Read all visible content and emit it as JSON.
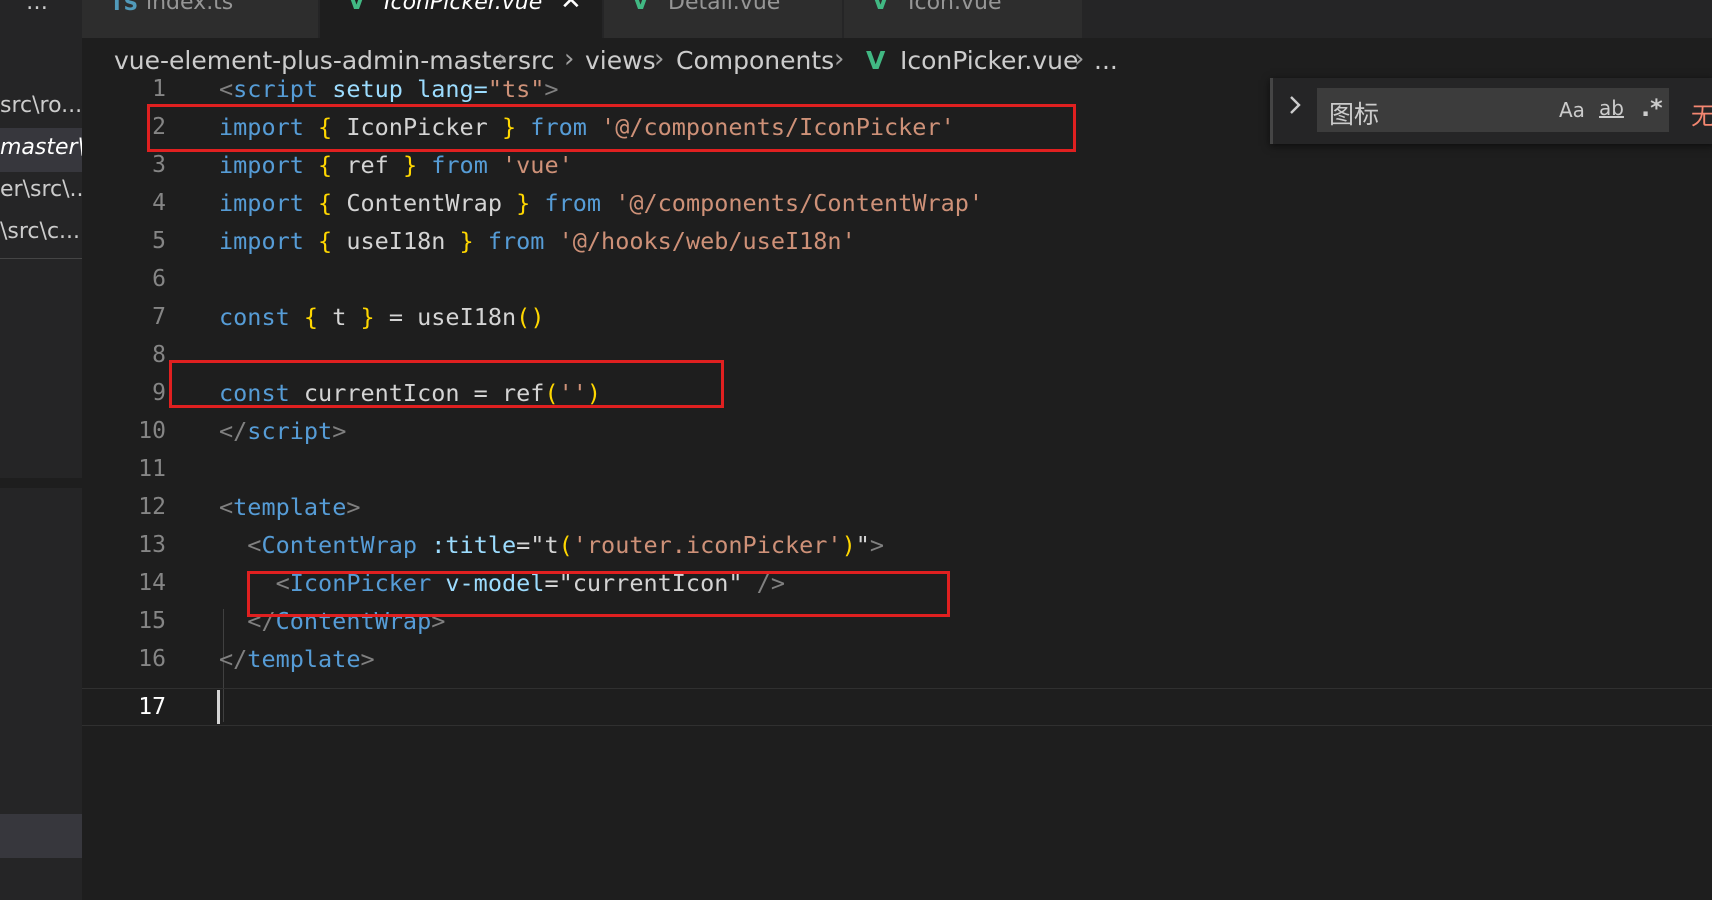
{
  "sidebar": {
    "overflow_label": "…",
    "items": [
      {
        "label": "src\\ro..."
      },
      {
        "label": "master\\..."
      },
      {
        "label": "er\\src\\..."
      },
      {
        "label": "\\src\\c..."
      }
    ]
  },
  "tabs": [
    {
      "icon": "TS",
      "label": "index.ts",
      "active": false
    },
    {
      "icon": "V",
      "label": "IconPicker.vue",
      "active": true,
      "close": "✕"
    },
    {
      "icon": "V",
      "label": "Detail.vue",
      "active": false
    },
    {
      "icon": "V",
      "label": "Icon.vue",
      "active": false
    }
  ],
  "breadcrumb": {
    "parts": [
      "vue-element-plus-admin-master",
      "src",
      "views",
      "Components",
      "IconPicker.vue",
      "..."
    ],
    "separator": "›",
    "file_icon": "V"
  },
  "editor": {
    "lines": [
      {
        "n": "1"
      },
      {
        "n": "2"
      },
      {
        "n": "3"
      },
      {
        "n": "4"
      },
      {
        "n": "5"
      },
      {
        "n": "6"
      },
      {
        "n": "7"
      },
      {
        "n": "8"
      },
      {
        "n": "9"
      },
      {
        "n": "10"
      },
      {
        "n": "11"
      },
      {
        "n": "12"
      },
      {
        "n": "13"
      },
      {
        "n": "14"
      },
      {
        "n": "15"
      },
      {
        "n": "16"
      },
      {
        "n": "17"
      }
    ],
    "code": {
      "l1": [
        "<",
        "script",
        " setup lang=",
        "\"ts\"",
        ">"
      ],
      "l2": [
        "import",
        " ",
        "{",
        " IconPicker ",
        "}",
        " ",
        "from",
        " ",
        "'@/components/IconPicker'"
      ],
      "l3": [
        "import",
        " ",
        "{",
        " ref ",
        "}",
        " ",
        "from",
        " ",
        "'vue'"
      ],
      "l4": [
        "import",
        " ",
        "{",
        " ContentWrap ",
        "}",
        " ",
        "from",
        " ",
        "'@/components/ContentWrap'"
      ],
      "l5": [
        "import",
        " ",
        "{",
        " useI18n ",
        "}",
        " ",
        "from",
        " ",
        "'@/hooks/web/useI18n'"
      ],
      "l7": [
        "const",
        " ",
        "{",
        " t ",
        "}",
        " = ",
        "useI18n",
        "()",
        ""
      ],
      "l9": [
        "const",
        " currentIcon = ",
        "ref",
        "(",
        "''",
        ")"
      ],
      "l10": [
        "</",
        "script",
        ">"
      ],
      "l12": [
        "<",
        "template",
        ">"
      ],
      "l13": [
        "  <",
        "ContentWrap",
        " ",
        ":title",
        "=",
        "\"",
        "t",
        "(",
        "'router.iconPicker'",
        ")",
        "\"",
        ">"
      ],
      "l14": [
        "    <",
        "IconPicker",
        " ",
        "v-model",
        "=",
        "\"currentIcon\"",
        " />"
      ],
      "l15": [
        "  </",
        "ContentWrap",
        ">"
      ],
      "l16": [
        "</",
        "template",
        ">"
      ]
    },
    "current_line": "17"
  },
  "find_widget": {
    "query": "图标",
    "match_case": "Aa",
    "whole_word": "ab",
    "regex": ".*",
    "result": "无结果"
  },
  "colors": {
    "highlight_box": "#e02020",
    "keyword": "#569cd6",
    "string": "#ce9178",
    "bracket": "#ffd700",
    "component": "#4ec9b0",
    "vue_icon": "#41b883"
  }
}
